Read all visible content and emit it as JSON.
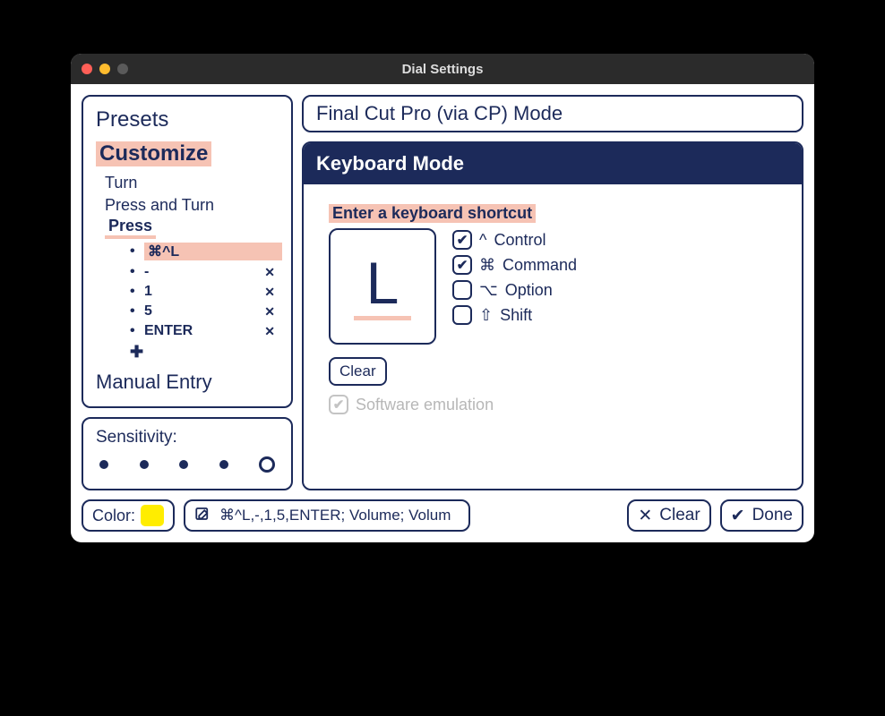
{
  "titlebar": {
    "title": "Dial Settings"
  },
  "sidebar": {
    "presets_label": "Presets",
    "customize_label": "Customize",
    "turn_label": "Turn",
    "press_turn_label": "Press and Turn",
    "press_label": "Press",
    "items": [
      {
        "label": "⌘^L",
        "deletable": false,
        "highlighted": true
      },
      {
        "label": "-",
        "deletable": true,
        "highlighted": false
      },
      {
        "label": "1",
        "deletable": true,
        "highlighted": false
      },
      {
        "label": "5",
        "deletable": true,
        "highlighted": false
      },
      {
        "label": "ENTER",
        "deletable": true,
        "highlighted": false
      }
    ],
    "manual_label": "Manual Entry"
  },
  "sensitivity": {
    "label": "Sensitivity:",
    "selected_index": 4,
    "count": 5
  },
  "mode": {
    "title": "Final Cut Pro (via CP) Mode"
  },
  "keyboard": {
    "header": "Keyboard Mode",
    "prompt": "Enter a keyboard shortcut",
    "key_letter": "L",
    "modifiers": {
      "control": {
        "symbol": "^",
        "label": "Control",
        "checked": true
      },
      "command": {
        "symbol": "⌘",
        "label": "Command",
        "checked": true
      },
      "option": {
        "symbol": "⌥",
        "label": "Option",
        "checked": false
      },
      "shift": {
        "symbol": "⇧",
        "label": "Shift",
        "checked": false
      }
    },
    "clear_label": "Clear",
    "software_emu_label": "Software emulation"
  },
  "footer": {
    "color_label": "Color:",
    "color_value": "#ffed00",
    "summary_text": "⌘^L,-,1,5,ENTER; Volume; Volum",
    "clear_label": "Clear",
    "done_label": "Done"
  }
}
